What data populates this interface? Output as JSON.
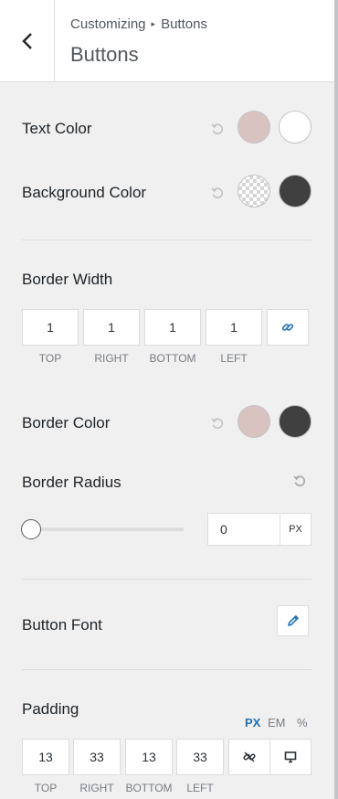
{
  "header": {
    "breadcrumb_parent": "Customizing",
    "breadcrumb_sep": "▸",
    "breadcrumb_current": "Buttons",
    "title": "Buttons"
  },
  "text_color": {
    "label": "Text Color",
    "normal": "#d8c3c0",
    "hover": "#ffffff"
  },
  "background_color": {
    "label": "Background Color",
    "normal": "transparent",
    "hover": "#404040"
  },
  "border_width": {
    "label": "Border Width",
    "values": {
      "top": "1",
      "right": "1",
      "bottom": "1",
      "left": "1"
    },
    "labels": {
      "top": "TOP",
      "right": "RIGHT",
      "bottom": "BOTTOM",
      "left": "LEFT"
    },
    "link_icon": "link-icon"
  },
  "border_color": {
    "label": "Border Color",
    "normal": "#d8c3c0",
    "hover": "#404040"
  },
  "border_radius": {
    "label": "Border Radius",
    "value": "0",
    "unit": "PX",
    "slider_level": 0
  },
  "button_font": {
    "label": "Button Font",
    "edit_icon": "pencil-icon"
  },
  "padding": {
    "label": "Padding",
    "units": [
      "PX",
      "EM",
      "%"
    ],
    "active_unit": "PX",
    "values": {
      "top": "13",
      "right": "33",
      "bottom": "13",
      "left": "33"
    },
    "labels": {
      "top": "TOP",
      "right": "RIGHT",
      "bottom": "BOTTOM",
      "left": "LEFT"
    },
    "unlink_icon": "unlink-icon",
    "device_icon": "desktop-icon"
  },
  "colors": {
    "accent": "#2271b1",
    "panel_bg": "#f0f0f1"
  }
}
